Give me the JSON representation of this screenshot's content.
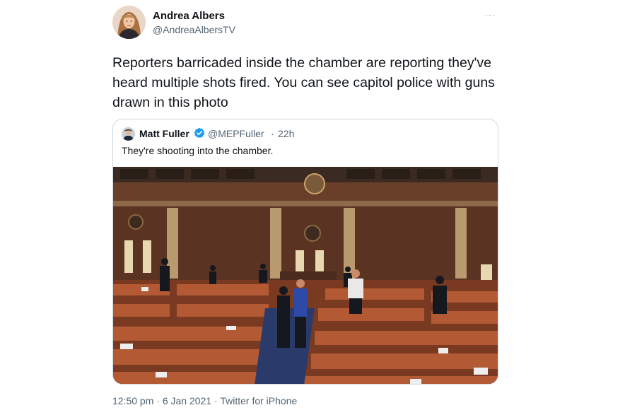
{
  "author": {
    "name": "Andrea Albers",
    "handle": "@AndreaAlbersTV",
    "more_icon": "ellipsis-icon",
    "more_label": "···"
  },
  "tweet_text": "Reporters barricaded inside the chamber are reporting they've heard multiple shots fired. You can see capitol police with guns drawn in this photo",
  "quoted_tweet": {
    "name": "Matt Fuller",
    "verified_icon": "verified-badge-icon",
    "handle": "@MEPFuller",
    "separator": "·",
    "time": "22h",
    "text": "They're shooting into the chamber.",
    "photo_icon": "house-chamber-photo"
  },
  "footer": {
    "time": "12:50 pm",
    "sep1": "·",
    "date": "6 Jan 2021",
    "sep2": "·",
    "source": "Twitter for iPhone"
  },
  "colors": {
    "text": "#0f1419",
    "secondary": "#536471",
    "border": "#cfd9de",
    "verified": "#1d9bf0"
  }
}
